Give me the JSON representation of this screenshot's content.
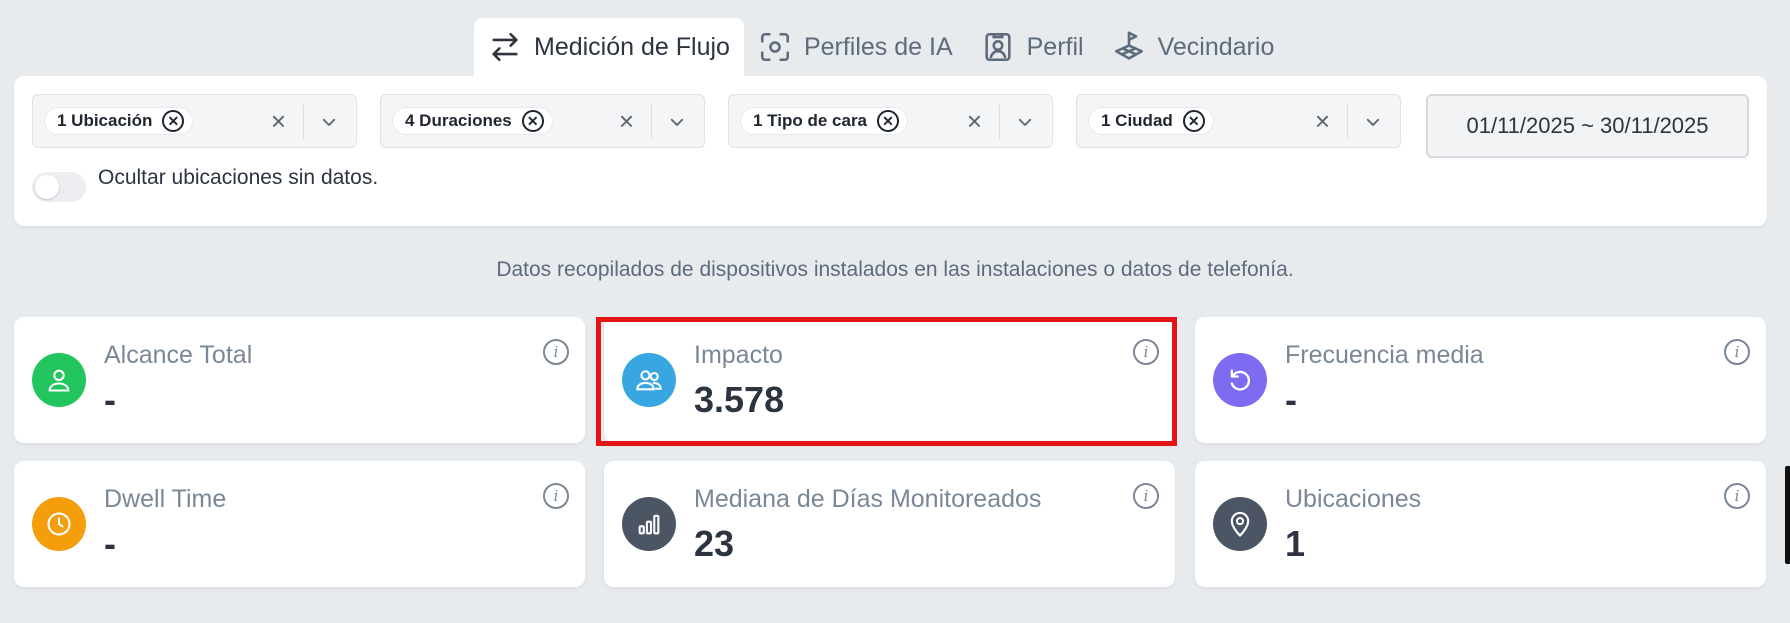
{
  "tabs": [
    {
      "label": "Medición de Flujo",
      "icon": "swap-arrows-icon",
      "active": true
    },
    {
      "label": "Perfiles de IA",
      "icon": "face-scan-icon",
      "active": false
    },
    {
      "label": "Perfil",
      "icon": "profile-card-icon",
      "active": false
    },
    {
      "label": "Vecindario",
      "icon": "map-location-icon",
      "active": false
    }
  ],
  "filters": [
    {
      "chip": "1 Ubicación"
    },
    {
      "chip": "4 Duraciones"
    },
    {
      "chip": "1 Tipo de cara"
    },
    {
      "chip": "1 Ciudad"
    }
  ],
  "date_range": "01/11/2025 ~ 30/11/2025",
  "toggle_label": "Ocultar ubicaciones sin datos.",
  "toggle_on": false,
  "info_text": "Datos recopilados de dispositivos instalados en las instalaciones o datos de telefonía.",
  "cards": [
    {
      "title": "Alcance Total",
      "value": "-",
      "icon": "user-icon",
      "color": "#22c55e"
    },
    {
      "title": "Impacto",
      "value": "3.578",
      "icon": "users-icon",
      "color": "#38a6e0"
    },
    {
      "title": "Frecuencia media",
      "value": "-",
      "icon": "refresh-icon",
      "color": "#7c6cf0"
    },
    {
      "title": "Dwell Time",
      "value": "-",
      "icon": "clock-icon",
      "color": "#f59e0b"
    },
    {
      "title": "Mediana de Días Monitoreados",
      "value": "23",
      "icon": "bar-chart-icon",
      "color": "#4b5563"
    },
    {
      "title": "Ubicaciones",
      "value": "1",
      "icon": "location-pin-icon",
      "color": "#4b5563"
    }
  ],
  "colors": {
    "highlight": "#e41414",
    "background": "#e8ebee"
  }
}
